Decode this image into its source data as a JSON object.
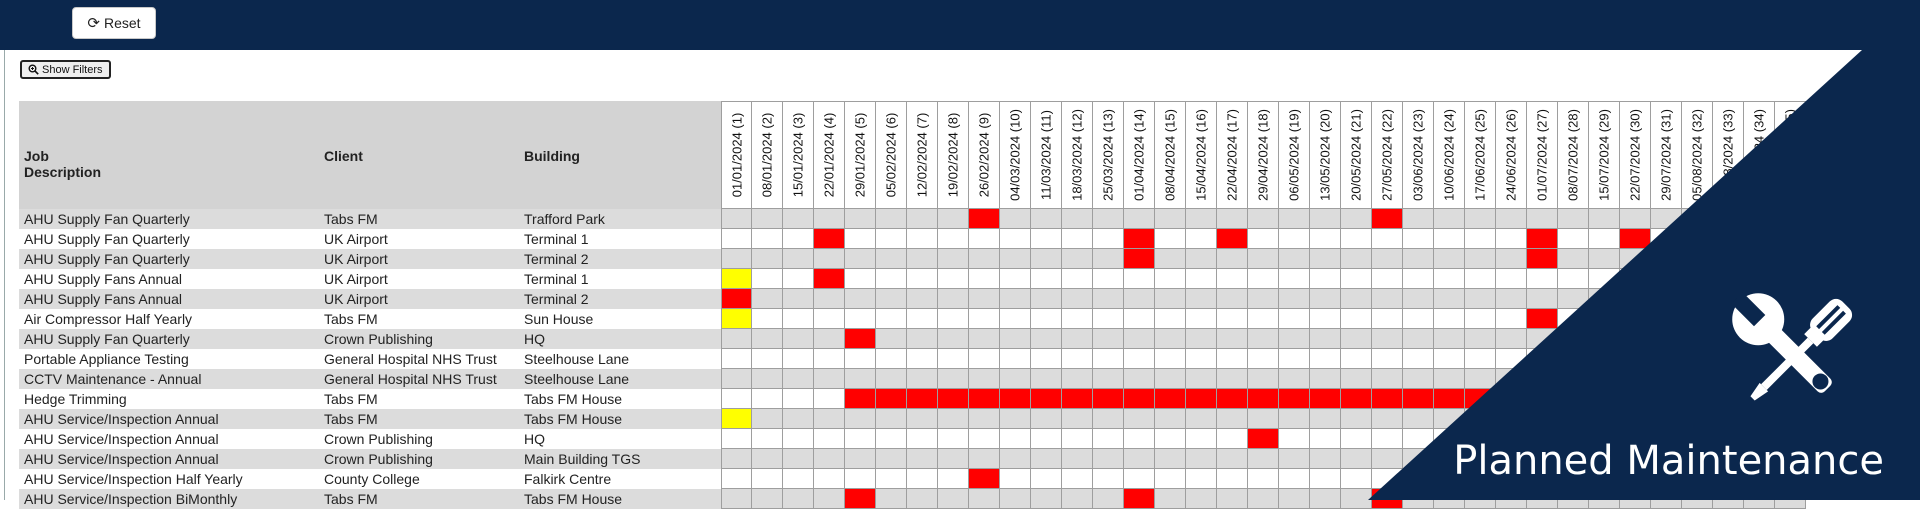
{
  "toolbar": {
    "reset_label": "Reset",
    "reset_icon": "refresh-icon"
  },
  "filters": {
    "show_label": "Show Filters",
    "icon": "zoom-icon"
  },
  "table": {
    "headers": [
      "Job Description",
      "Client",
      "Building"
    ],
    "weeks": [
      "01/01/2024 (1)",
      "08/01/2024 (2)",
      "15/01/2024 (3)",
      "22/01/2024 (4)",
      "29/01/2024 (5)",
      "05/02/2024 (6)",
      "12/02/2024 (7)",
      "19/02/2024 (8)",
      "26/02/2024 (9)",
      "04/03/2024 (10)",
      "11/03/2024 (11)",
      "18/03/2024 (12)",
      "25/03/2024 (13)",
      "01/04/2024 (14)",
      "08/04/2024 (15)",
      "15/04/2024 (16)",
      "22/04/2024 (17)",
      "29/04/2024 (18)",
      "06/05/2024 (19)",
      "13/05/2024 (20)",
      "20/05/2024 (21)",
      "27/05/2024 (22)",
      "03/06/2024 (23)",
      "10/06/2024 (24)",
      "17/06/2024 (25)",
      "24/06/2024 (26)",
      "01/07/2024 (27)",
      "08/07/2024 (28)",
      "15/07/2024 (29)",
      "22/07/2024 (30)",
      "29/07/2024 (31)",
      "05/08/2024 (32)",
      "12/08/2024 (33)",
      "19/08/2024 (34)",
      "26/08/2024 (35)"
    ],
    "rows": [
      {
        "job": "AHU Supply Fan Quarterly",
        "client": "Tabs FM",
        "building": "Trafford Park",
        "marks": {
          "8": "R",
          "21": "R"
        }
      },
      {
        "job": "AHU Supply Fan Quarterly",
        "client": "UK Airport",
        "building": "Terminal 1",
        "marks": {
          "3": "R",
          "13": "R",
          "16": "R",
          "26": "R",
          "29": "R"
        }
      },
      {
        "job": "AHU Supply Fan Quarterly",
        "client": "UK Airport",
        "building": "Terminal 2",
        "marks": {
          "13": "R",
          "26": "R"
        }
      },
      {
        "job": "AHU Supply Fans Annual",
        "client": "UK Airport",
        "building": "Terminal 1",
        "marks": {
          "0": "Y",
          "3": "R"
        }
      },
      {
        "job": "AHU Supply Fans Annual",
        "client": "UK Airport",
        "building": "Terminal 2",
        "marks": {
          "0": "R"
        }
      },
      {
        "job": "Air Compressor Half Yearly",
        "client": "Tabs FM",
        "building": "Sun House",
        "marks": {
          "0": "Y",
          "26": "R"
        }
      },
      {
        "job": "AHU Supply Fan Quarterly",
        "client": "Crown Publishing",
        "building": "HQ",
        "marks": {
          "4": "R"
        }
      },
      {
        "job": "Portable Appliance Testing",
        "client": "General Hospital NHS Trust",
        "building": "Steelhouse Lane",
        "marks": {}
      },
      {
        "job": "CCTV Maintenance - Annual",
        "client": "General Hospital NHS Trust",
        "building": "Steelhouse Lane",
        "marks": {}
      },
      {
        "job": "Hedge Trimming",
        "client": "Tabs FM",
        "building": "Tabs FM House",
        "marks": {
          "4": "R",
          "5": "R",
          "6": "R",
          "7": "R",
          "8": "R",
          "9": "R",
          "10": "R",
          "11": "R",
          "12": "R",
          "13": "R",
          "14": "R",
          "15": "R",
          "16": "R",
          "17": "R",
          "18": "R",
          "19": "R",
          "20": "R",
          "21": "R",
          "22": "R",
          "23": "R",
          "24": "R"
        }
      },
      {
        "job": "AHU Service/Inspection Annual",
        "client": "Tabs FM",
        "building": "Tabs FM House",
        "marks": {
          "0": "Y"
        }
      },
      {
        "job": "AHU Service/Inspection Annual",
        "client": "Crown Publishing",
        "building": "HQ",
        "marks": {
          "17": "R"
        }
      },
      {
        "job": "AHU Service/Inspection Annual",
        "client": "Crown Publishing",
        "building": "Main Building TGS",
        "marks": {}
      },
      {
        "job": "AHU Service/Inspection Half Yearly",
        "client": "County College",
        "building": "Falkirk Centre",
        "marks": {
          "8": "R"
        }
      },
      {
        "job": "AHU Service/Inspection BiMonthly",
        "client": "Tabs FM",
        "building": "Tabs FM House",
        "marks": {
          "4": "R",
          "13": "R",
          "21": "R"
        }
      }
    ]
  },
  "banner": {
    "title": "Planned Maintenance",
    "icon": "tools-icon"
  },
  "colors": {
    "navy": "#0b274d",
    "red": "#ff0000",
    "yellow": "#ffff00",
    "gray": "#dcdcdc",
    "header": "#d3d3d3"
  }
}
